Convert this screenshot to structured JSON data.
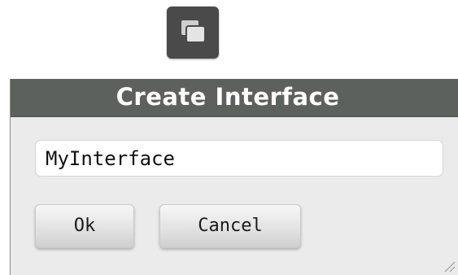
{
  "launcher": {
    "icon": "windows-stack-icon"
  },
  "dialog": {
    "title": "Create Interface",
    "name_input": {
      "value": "MyInterface"
    },
    "ok_label": "Ok",
    "cancel_label": "Cancel",
    "resize_icon": "resize-grip-icon"
  },
  "colors": {
    "titlebar": "#5d615d",
    "dialog_background": "#ebebeb",
    "icon_background": "#4a4a4a"
  }
}
